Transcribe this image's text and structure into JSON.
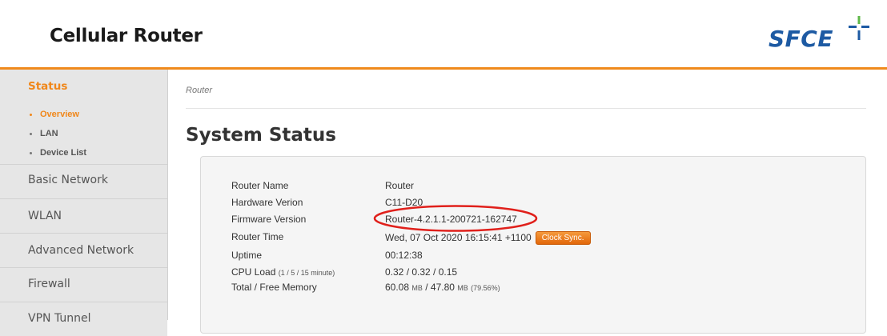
{
  "header": {
    "title": "Cellular Router",
    "logo_text": "SFCE"
  },
  "colors": {
    "accent": "#f08a1c",
    "brand_blue": "#1d5aa3",
    "annotation_red": "#e0201b"
  },
  "sidebar": {
    "sections": [
      {
        "label": "Status",
        "active": true,
        "items": [
          {
            "label": "Overview",
            "active": true
          },
          {
            "label": "LAN",
            "active": false
          },
          {
            "label": "Device List",
            "active": false
          }
        ]
      },
      {
        "label": "Basic Network"
      },
      {
        "label": "WLAN"
      },
      {
        "label": "Advanced Network"
      },
      {
        "label": "Firewall"
      },
      {
        "label": "VPN Tunnel"
      }
    ]
  },
  "main": {
    "breadcrumb": "Router",
    "page_title": "System Status",
    "status": {
      "router_name": {
        "label": "Router Name",
        "value": "Router"
      },
      "hardware_version": {
        "label": "Hardware Verion",
        "value": "C11-D20"
      },
      "firmware_version": {
        "label": "Firmware Version",
        "value": "Router-4.2.1.1-200721-162747"
      },
      "router_time": {
        "label": "Router Time",
        "value": "Wed, 07 Oct 2020 16:15:41 +1100",
        "button": "Clock Sync."
      },
      "uptime": {
        "label": "Uptime",
        "value": "00:12:38"
      },
      "cpu_load": {
        "label": "CPU Load",
        "label_note": "(1 / 5 / 15 minute)",
        "value": "0.32 / 0.32 / 0.15"
      },
      "memory": {
        "label": "Total / Free Memory",
        "total": "60.08",
        "total_unit": "MB",
        "separator": "/",
        "free": "47.80",
        "free_unit": "MB",
        "percent": "(79.56%)"
      }
    }
  }
}
